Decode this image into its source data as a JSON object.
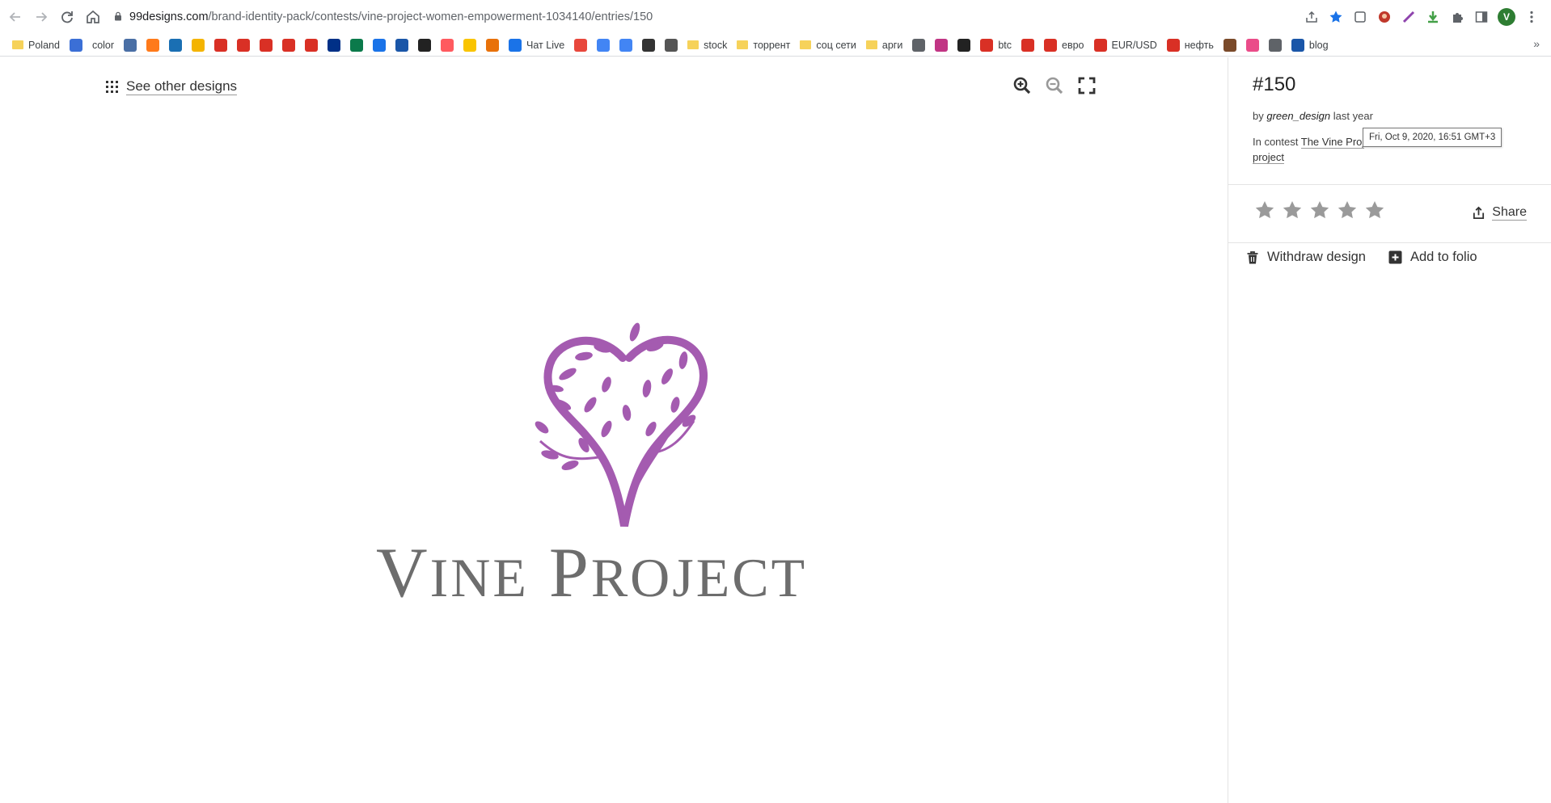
{
  "browser": {
    "url_host": "99designs.com",
    "url_path": "/brand-identity-pack/contests/vine-project-women-empowerment-1034140/entries/150",
    "profile_initial": "V",
    "bookmarks": [
      {
        "label": "Poland",
        "icon": "folder"
      },
      {
        "label": "",
        "icon": "at-icon",
        "color": "#3b6fd6"
      },
      {
        "label": "color",
        "icon": "none"
      },
      {
        "label": "",
        "icon": "clock-icon",
        "color": "#4a6fa5"
      },
      {
        "label": "",
        "icon": "circle-icon",
        "color": "#ff7a1a"
      },
      {
        "label": "",
        "icon": "e-icon",
        "color": "#1a6fb3"
      },
      {
        "label": "",
        "icon": "s-icon",
        "color": "#f4b400"
      },
      {
        "label": "",
        "icon": "square-icon",
        "color": "#d93025"
      },
      {
        "label": "",
        "icon": "umbrella-icon",
        "color": "#d93025"
      },
      {
        "label": "",
        "icon": "a-icon",
        "color": "#d93025"
      },
      {
        "label": "",
        "icon": "a-icon",
        "color": "#d93025"
      },
      {
        "label": "",
        "icon": "r-icon",
        "color": "#d93025"
      },
      {
        "label": "",
        "icon": "paypal-icon",
        "color": "#003087"
      },
      {
        "label": "",
        "icon": "tree-icon",
        "color": "#0b7a4b"
      },
      {
        "label": "",
        "icon": "u-icon",
        "color": "#1a73e8"
      },
      {
        "label": "",
        "icon": "ep-icon",
        "color": "#1a56a8"
      },
      {
        "label": "",
        "icon": "box-icon",
        "color": "#222222"
      },
      {
        "label": "",
        "icon": "airbnb-icon",
        "color": "#ff5a5f"
      },
      {
        "label": "",
        "icon": "bee-icon",
        "color": "#f9c400"
      },
      {
        "label": "",
        "icon": "ring-icon",
        "color": "#e8710a"
      },
      {
        "label": "Чат Live",
        "icon": "ring-icon",
        "color": "#1a73e8"
      },
      {
        "label": "",
        "icon": "99d-icon",
        "color": "#e8473c"
      },
      {
        "label": "",
        "icon": "google-icon",
        "color": "#4285f4"
      },
      {
        "label": "",
        "icon": "translate-icon",
        "color": "#4285f4"
      },
      {
        "label": "",
        "icon": "chip-icon",
        "color": "#333333"
      },
      {
        "label": "",
        "icon": "owl-icon",
        "color": "#555555"
      },
      {
        "label": "stock",
        "icon": "folder"
      },
      {
        "label": "торрент",
        "icon": "folder"
      },
      {
        "label": "соц сети",
        "icon": "folder"
      },
      {
        "label": "арги",
        "icon": "folder"
      },
      {
        "label": "",
        "icon": "globe-icon",
        "color": "#5f6368"
      },
      {
        "label": "",
        "icon": "instagram-icon",
        "color": "#c13584"
      },
      {
        "label": "",
        "icon": "camera-icon",
        "color": "#222222"
      },
      {
        "label": "btc",
        "icon": "f-icon",
        "color": "#d93025"
      },
      {
        "label": "",
        "icon": "f-icon",
        "color": "#d93025"
      },
      {
        "label": "евро",
        "icon": "f-icon",
        "color": "#d93025"
      },
      {
        "label": "EUR/USD",
        "icon": "f-icon",
        "color": "#d93025"
      },
      {
        "label": "нефть",
        "icon": "f-icon",
        "color": "#d93025"
      },
      {
        "label": "",
        "icon": "book-icon",
        "color": "#7a4a2a"
      },
      {
        "label": "",
        "icon": "dribbble-icon",
        "color": "#ea4c89"
      },
      {
        "label": "",
        "icon": "globe-icon",
        "color": "#5f6368"
      },
      {
        "label": "blog",
        "icon": "blog-icon",
        "color": "#1a56a8"
      }
    ]
  },
  "main": {
    "see_other_label": "See other designs",
    "logo": {
      "word1_cap": "V",
      "word1_rest": "INE",
      "word2_cap": "P",
      "word2_rest": "ROJECT",
      "heart_color": "#a45bb0",
      "text_color": "#6d6d6d"
    }
  },
  "side": {
    "entry_number": "#150",
    "by_prefix": "by",
    "author": "green_design",
    "time_ago": "last year",
    "contest_prefix": "In contest",
    "contest_name": "The Vine Project women empowerment project",
    "contest_visible_1": "The Vine Proj",
    "contest_visible_2": "project",
    "tooltip": "Fri, Oct 9, 2020, 16:51 GMT+3",
    "rating": 0,
    "rating_max": 5,
    "share_label": "Share",
    "withdraw_label": "Withdraw design",
    "add_folio_label": "Add to folio"
  }
}
